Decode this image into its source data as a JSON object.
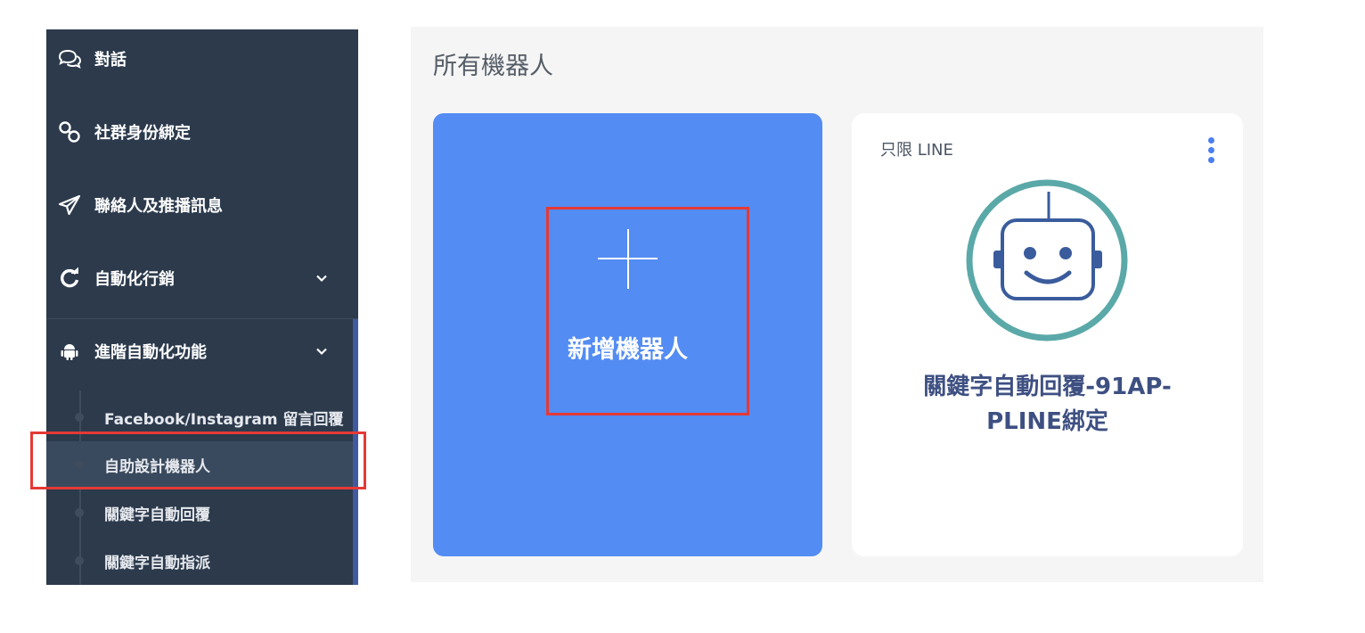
{
  "sidebar": {
    "items": [
      {
        "label": "對話",
        "icon": "chat-bubbles-icon"
      },
      {
        "label": "社群身份綁定",
        "icon": "link-icon"
      },
      {
        "label": "聯絡人及推播訊息",
        "icon": "paper-plane-icon"
      },
      {
        "label": "自動化行銷",
        "icon": "refresh-icon"
      },
      {
        "label": "進階自動化功能",
        "icon": "android-icon"
      }
    ],
    "sub_items": [
      {
        "label": "Facebook/Instagram 留言回覆"
      },
      {
        "label": "自助設計機器人"
      },
      {
        "label": "關鍵字自動回覆"
      },
      {
        "label": "關鍵字自動指派"
      }
    ],
    "selected_sub_item": "自助設計機器人"
  },
  "main": {
    "title": "所有機器人",
    "add_card": {
      "label": "新增機器人",
      "icon": "plus-icon"
    },
    "bot_cards": [
      {
        "channel": "只限 LINE",
        "name": "關鍵字自動回覆-91AP-\nPLINE綁定",
        "avatar_icon": "robot-face-icon"
      }
    ]
  },
  "colors": {
    "sidebar_bg": "#2c3a4c",
    "accent_blue": "#538cf3",
    "highlight_red": "#e53935",
    "bot_ring": "#5aa9a8",
    "bot_face": "#3a5c9c"
  }
}
